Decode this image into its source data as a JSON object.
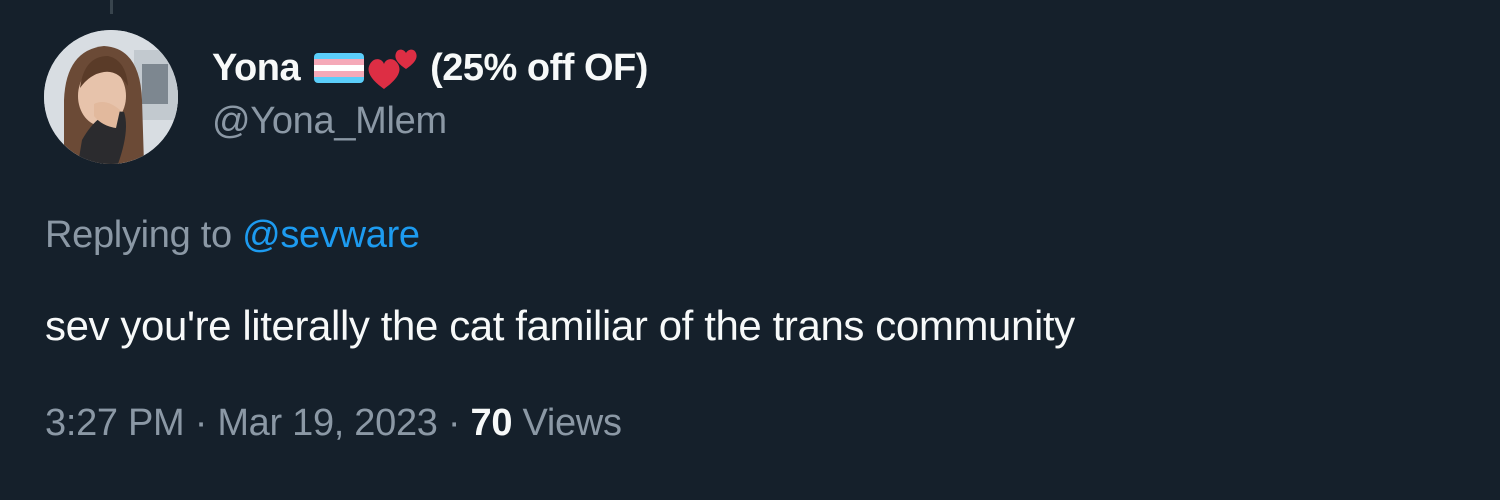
{
  "author": {
    "display_name": "Yona",
    "promo": "(25% off OF)",
    "handle": "@Yona_Mlem",
    "emoji": [
      "transgender-flag-icon",
      "two-hearts-icon"
    ]
  },
  "reply": {
    "prefix": "Replying to",
    "mention": "@sevware"
  },
  "tweet": {
    "text": "sev you're literally the cat familiar of the trans community"
  },
  "meta": {
    "time": "3:27 PM",
    "separator": "·",
    "date": "Mar 19, 2023",
    "views_count": "70",
    "views_label": "Views"
  },
  "colors": {
    "background": "#15202b",
    "primary_text": "#f7f9f9",
    "secondary_text": "#8b98a5",
    "link": "#1d9bf0"
  }
}
